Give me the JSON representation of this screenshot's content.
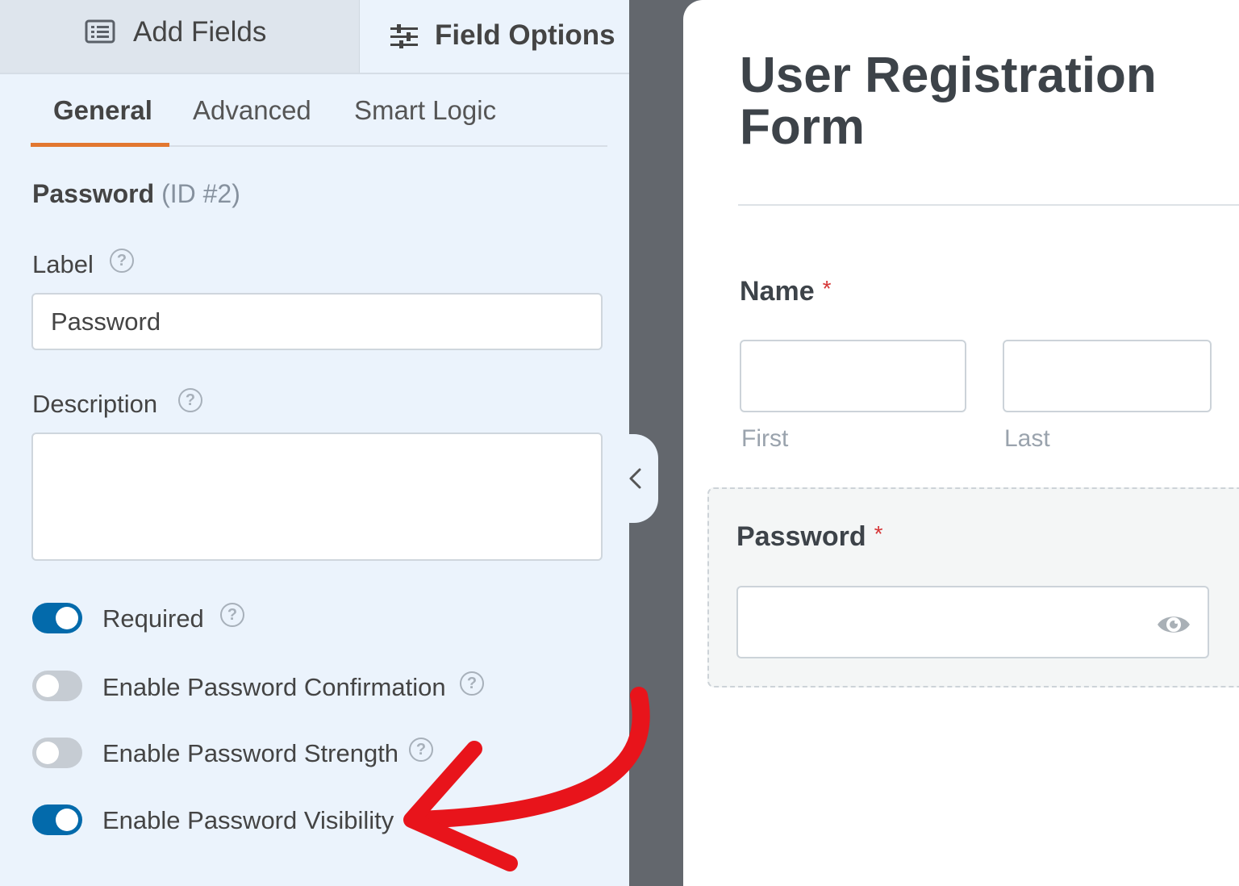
{
  "top_tabs": {
    "add_fields": "Add Fields",
    "field_options": "Field Options"
  },
  "sub_tabs": {
    "general": "General",
    "advanced": "Advanced",
    "smart_logic": "Smart Logic"
  },
  "field": {
    "name": "Password",
    "id": "(ID #2)"
  },
  "options": {
    "label_title": "Label",
    "label_value": "Password",
    "description_title": "Description",
    "description_value": ""
  },
  "toggles": [
    {
      "label": "Required",
      "on": true
    },
    {
      "label": "Enable Password Confirmation",
      "on": false
    },
    {
      "label": "Enable Password Strength",
      "on": false
    },
    {
      "label": "Enable Password Visibility",
      "on": true
    }
  ],
  "preview": {
    "title": "User Registration Form",
    "name_label": "Name",
    "required_mark": "*",
    "first_sublabel": "First",
    "last_sublabel": "Last",
    "password_label": "Password"
  },
  "colors": {
    "accent_orange": "#e27730",
    "toggle_on": "#036aab",
    "toggle_off": "#c6ccd3",
    "required_red": "#d63637",
    "arrow_red": "#e8141b"
  },
  "icons": {
    "add_fields": "list-icon",
    "field_options": "sliders-icon",
    "help": "question-circle-icon",
    "collapse": "chevron-left-icon",
    "visibility": "eye-icon"
  }
}
